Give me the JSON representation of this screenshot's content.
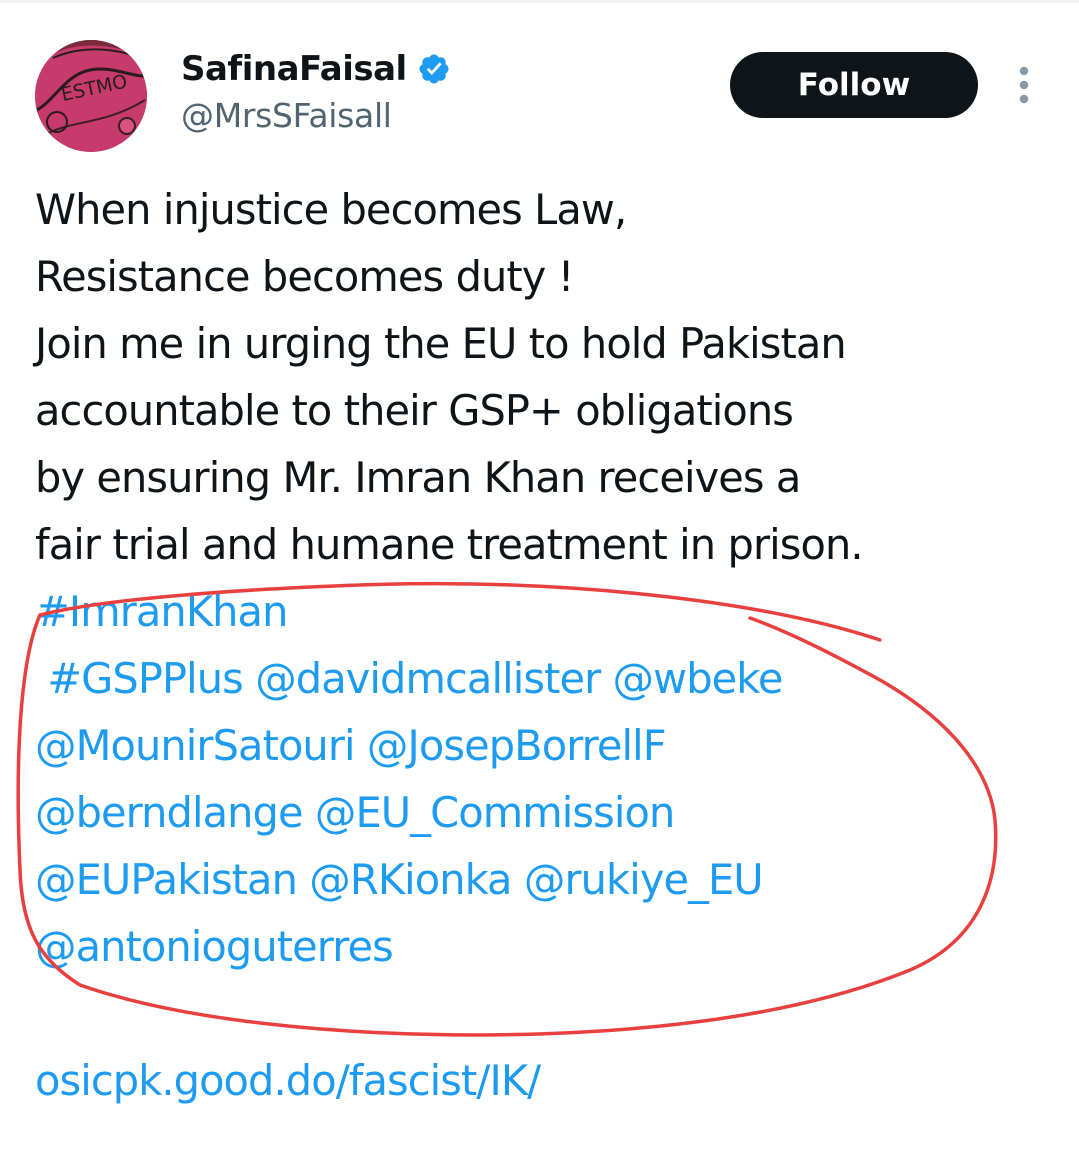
{
  "author": {
    "display_name": "SafinaFaisal",
    "handle": "@MrsSFaisall",
    "verified": true,
    "avatar_icon": "profile-avatar-icon",
    "avatar_text": "ESTMO"
  },
  "actions": {
    "follow_label": "Follow",
    "more_icon": "more-options-icon"
  },
  "tweet": {
    "lines": [
      "When injustice becomes Law,",
      "Resistance becomes duty !",
      "Join me in urging the EU to hold Pakistan",
      "accountable to their GSP+ obligations",
      "by ensuring Mr. Imran Khan receives a",
      "fair trial and humane treatment in prison."
    ],
    "tag_lines": [
      [
        "#ImranKhan"
      ],
      [
        "#GSPPlus",
        "@davidmcallister",
        "@wbeke"
      ],
      [
        "@MounirSatouri",
        "@JosepBorrellF"
      ],
      [
        "@berndlange",
        "@EU_Commission"
      ],
      [
        "@EUPakistan",
        "@RKionka",
        "@rukiye_EU"
      ],
      [
        "@antonioguterres"
      ]
    ],
    "link": "osicpk.good.do/fascist/IK/"
  },
  "colors": {
    "text": "#0f1419",
    "secondary_text": "#536471",
    "link": "#1d9bf0",
    "verified_badge": "#1d9bf0",
    "follow_button_bg": "#0f1419",
    "annotation_circle": "#e8403f"
  }
}
